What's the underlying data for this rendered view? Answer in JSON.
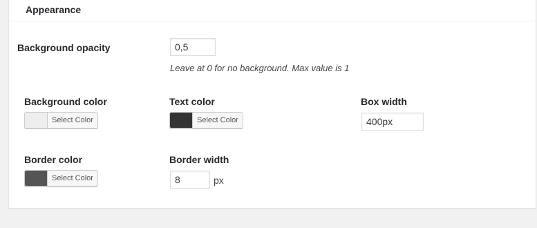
{
  "section": {
    "title": "Appearance"
  },
  "background_opacity": {
    "label": "Background opacity",
    "value": "0,5",
    "description": "Leave at 0 for no background. Max value is 1"
  },
  "background_color": {
    "label": "Background color",
    "button_label": "Select Color",
    "swatch": "#eeeeee"
  },
  "text_color": {
    "label": "Text color",
    "button_label": "Select Color",
    "swatch": "#333333"
  },
  "box_width": {
    "label": "Box width",
    "value": "400px"
  },
  "border_color": {
    "label": "Border color",
    "button_label": "Select Color",
    "swatch": "#555555"
  },
  "border_width": {
    "label": "Border width",
    "value": "8",
    "unit": "px"
  }
}
